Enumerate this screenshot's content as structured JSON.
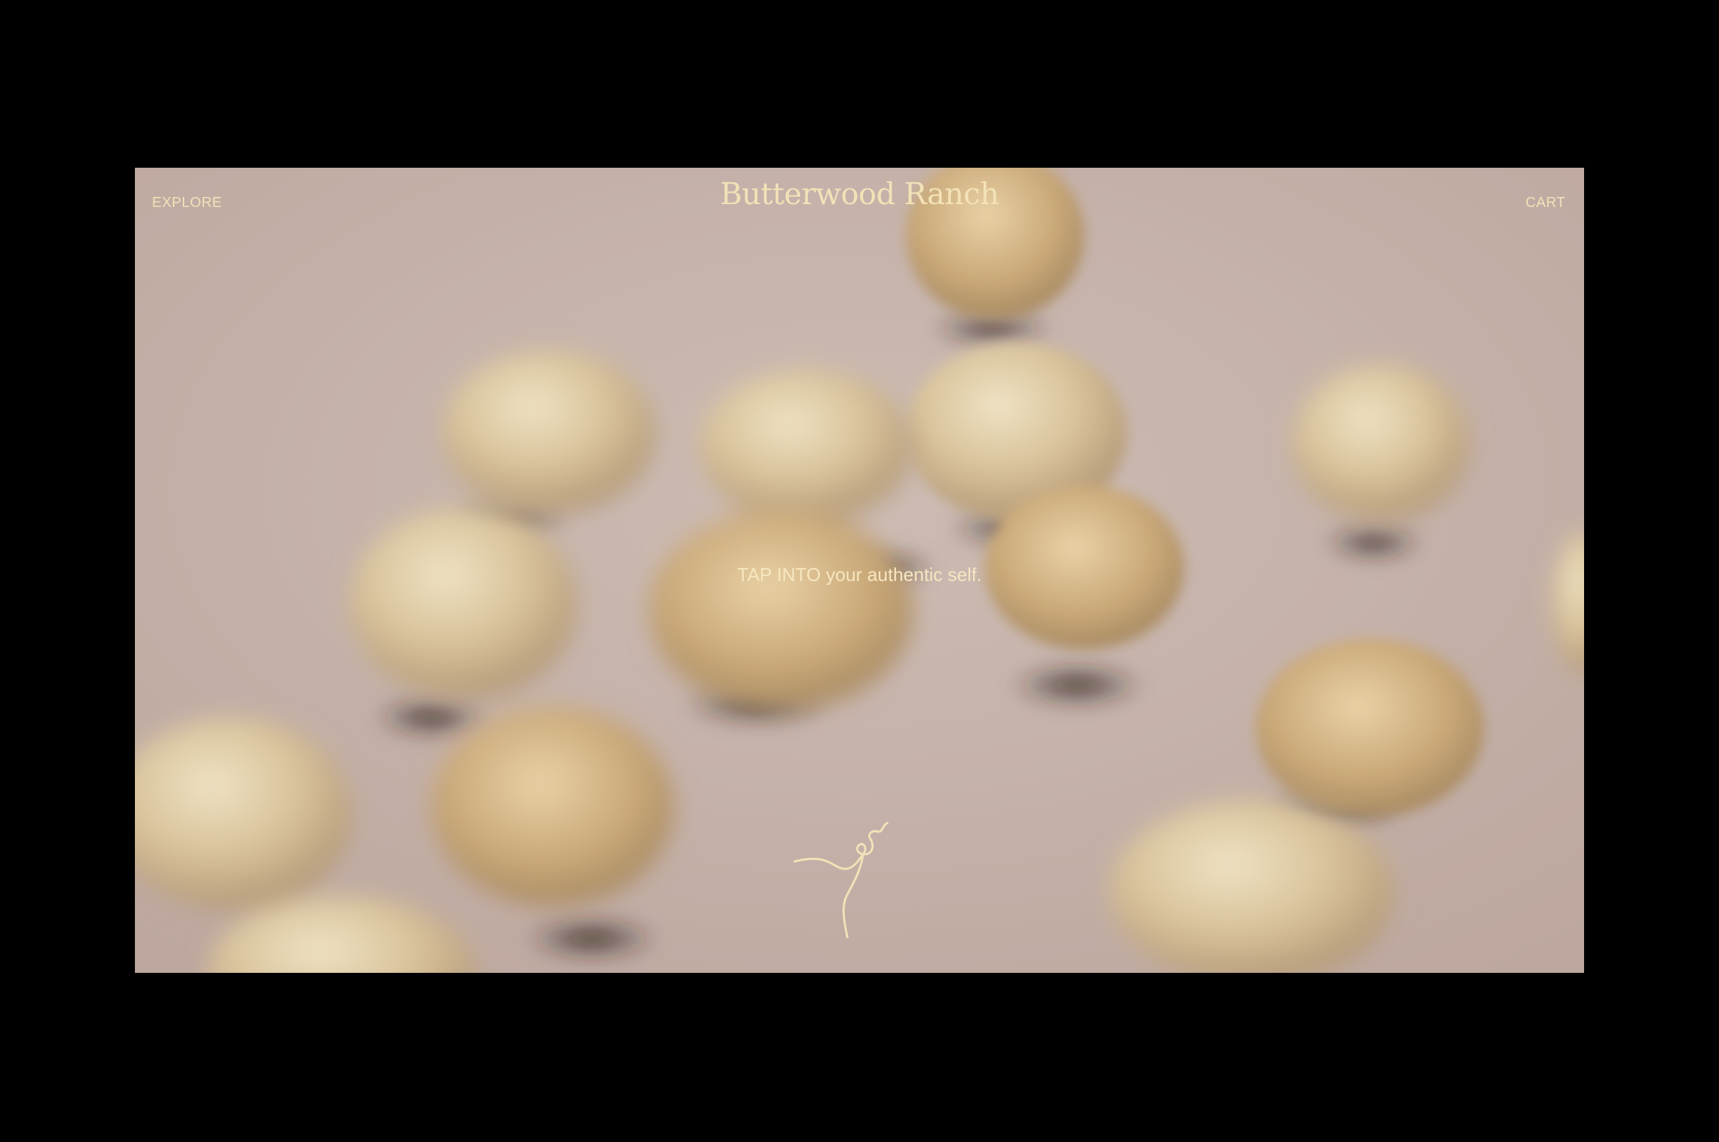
{
  "header": {
    "explore_label": "EXPLORE",
    "brand_name": "Butterwood Ranch",
    "cart_label": "CART"
  },
  "hero": {
    "tagline": "TAP INTO your authentic self.",
    "background_description_icon": "blurred-cream-spheres-photo",
    "logo_icon": "squiggle-logo-icon"
  },
  "colors": {
    "page_background": "#000000",
    "hero_background": "#c9b7b0",
    "accent_text": "#f3e2b8"
  }
}
